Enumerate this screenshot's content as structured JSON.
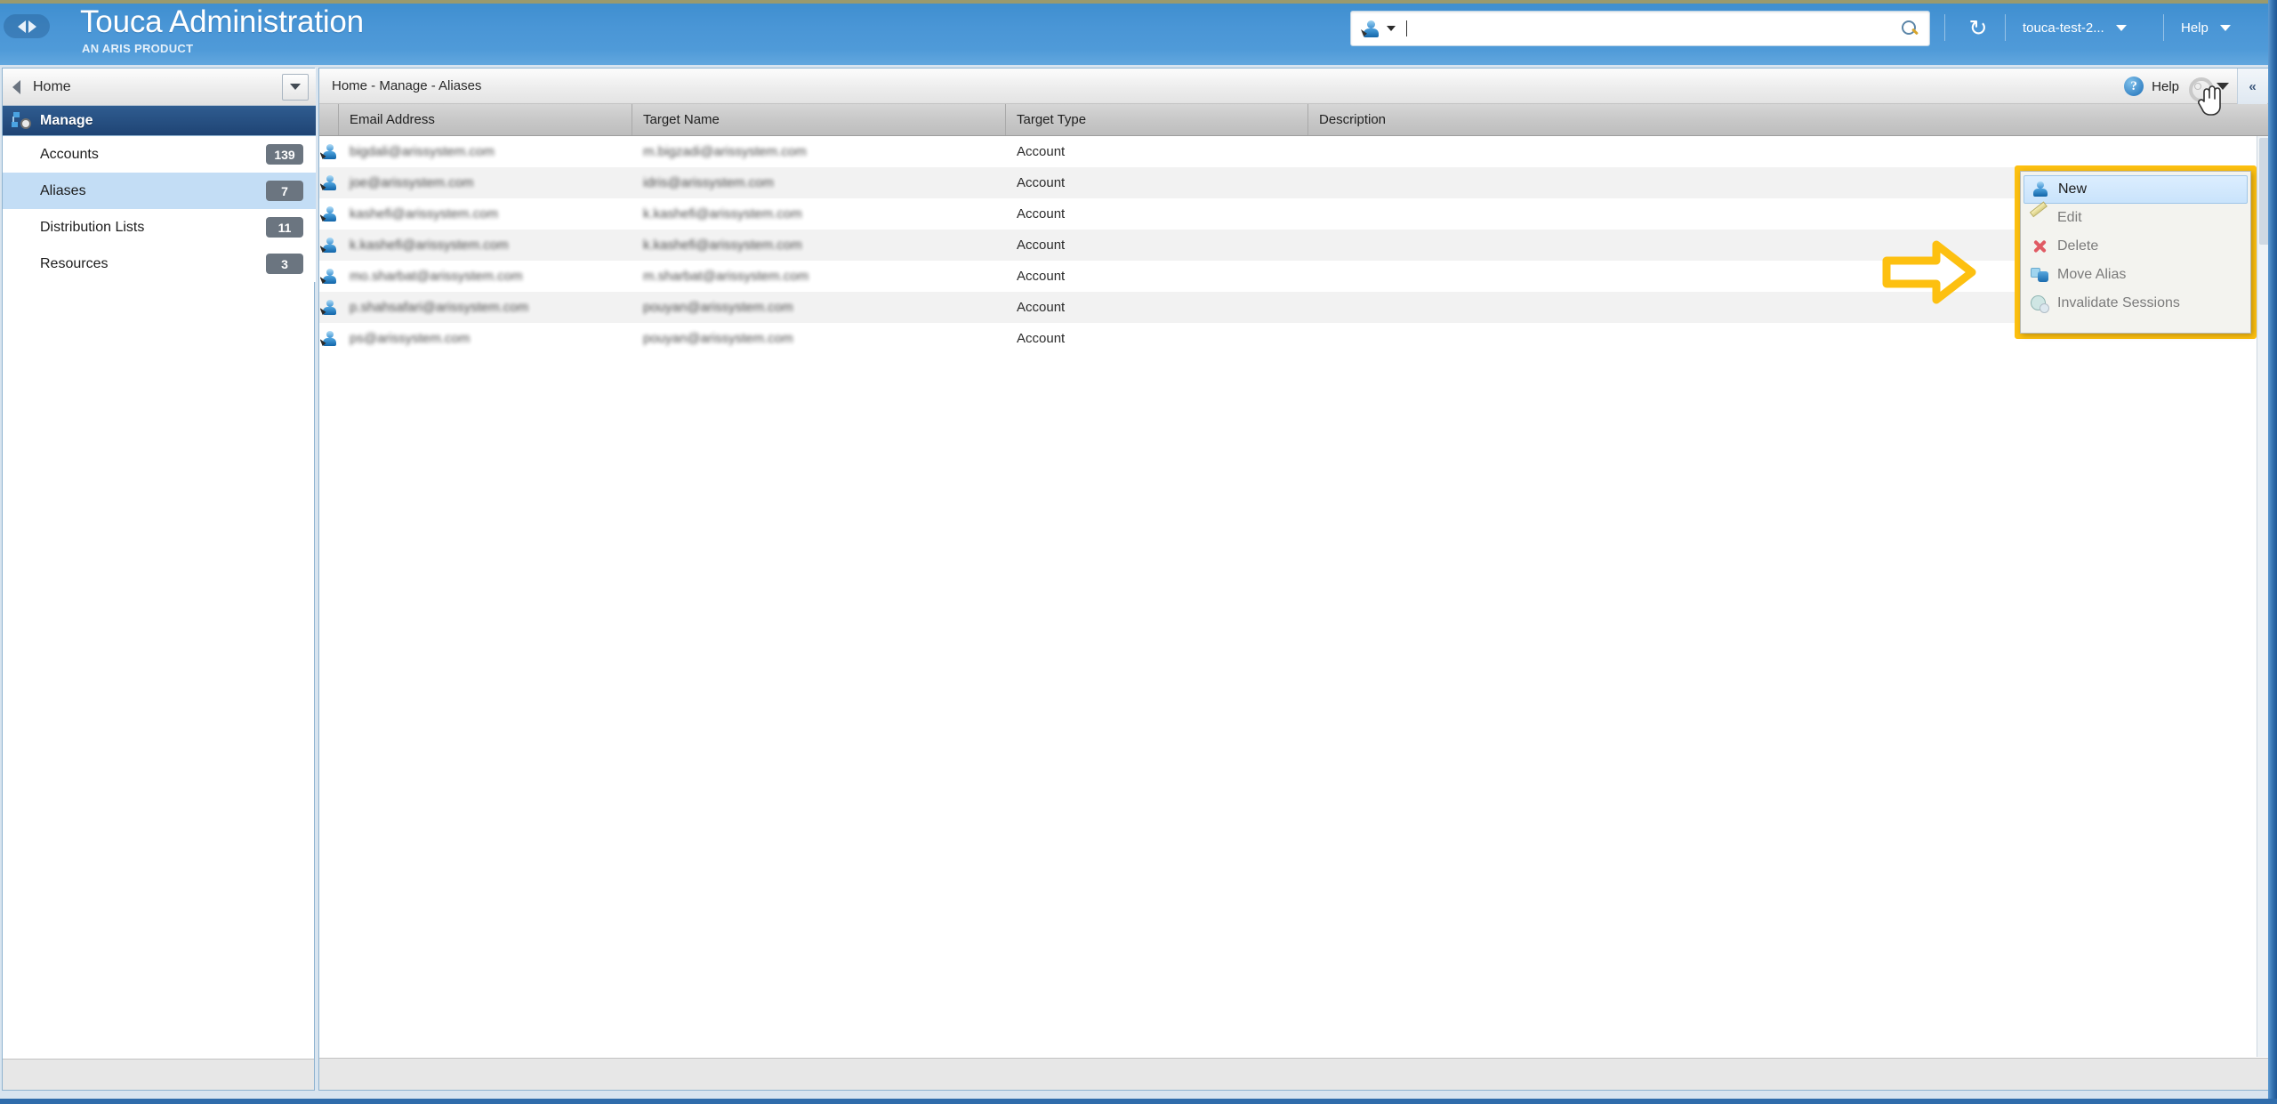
{
  "header": {
    "title": "Touca Administration",
    "subtitle": "AN ARIS PRODUCT",
    "nav_back_icon": "triangle-left-icon",
    "nav_forward_icon": "triangle-right-icon",
    "search": {
      "placeholder": "",
      "value": "",
      "scope_icon": "user-scope-icon",
      "submit_icon": "magnifier-icon"
    },
    "refresh_label": "↻",
    "account_menu": "touca-test-2...",
    "help_menu": "Help"
  },
  "sidebar": {
    "home_label": "Home",
    "section_label": "Manage",
    "items": [
      {
        "label": "Accounts",
        "badge": "139",
        "selected": false
      },
      {
        "label": "Aliases",
        "badge": "7",
        "selected": true
      },
      {
        "label": "Distribution Lists",
        "badge": "11",
        "selected": false
      },
      {
        "label": "Resources",
        "badge": "3",
        "selected": false
      }
    ]
  },
  "content": {
    "breadcrumb": "Home - Manage - Aliases",
    "help_label": "Help",
    "collapse_label": "«",
    "columns": [
      "Email Address",
      "Target Name",
      "Target Type",
      "Description"
    ],
    "rows": [
      {
        "email": "bigdali@arissystem.com",
        "target": "m.bigzadi@arissystem.com",
        "type": "Account",
        "description": ""
      },
      {
        "email": "joe@arissystem.com",
        "target": "idris@arissystem.com",
        "type": "Account",
        "description": ""
      },
      {
        "email": "kashefi@arissystem.com",
        "target": "k.kashefi@arissystem.com",
        "type": "Account",
        "description": ""
      },
      {
        "email": "k.kashefi@arissystem.com",
        "target": "k.kashefi@arissystem.com",
        "type": "Account",
        "description": ""
      },
      {
        "email": "mo.sharbat@arissystem.com",
        "target": "m.sharbat@arissystem.com",
        "type": "Account",
        "description": ""
      },
      {
        "email": "p.shahsafari@arissystem.com",
        "target": "pouyan@arissystem.com",
        "type": "Account",
        "description": ""
      },
      {
        "email": "ps@arissystem.com",
        "target": "pouyan@arissystem.com",
        "type": "Account",
        "description": ""
      }
    ]
  },
  "context_menu": {
    "items": [
      {
        "label": "New",
        "icon": "new-alias-icon",
        "enabled": true
      },
      {
        "label": "Edit",
        "icon": "pencil-icon",
        "enabled": false
      },
      {
        "label": "Delete",
        "icon": "red-x-icon",
        "enabled": false
      },
      {
        "label": "Move Alias",
        "icon": "move-alias-icon",
        "enabled": false
      },
      {
        "label": "Invalidate Sessions",
        "icon": "globe-invalidate-icon",
        "enabled": false
      }
    ]
  },
  "annotation": {
    "arrow_color": "#fdc010",
    "highlight_color": "#fdc010"
  }
}
